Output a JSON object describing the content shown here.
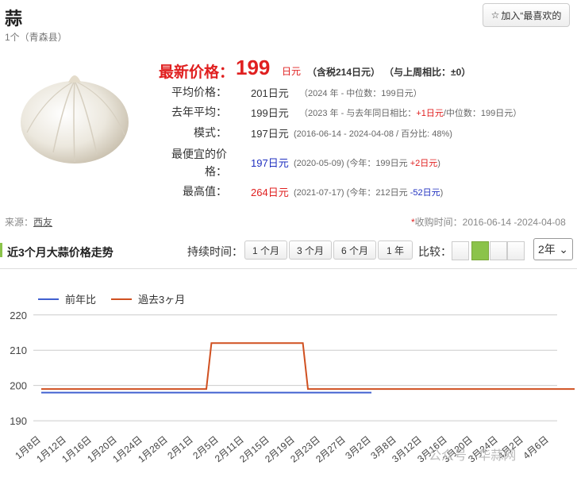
{
  "header": {
    "title": "蒜",
    "subtitle": "1个（青森县）",
    "favorite_label": "加入“最喜欢的"
  },
  "price": {
    "latest_label": "最新价格：",
    "latest_value": "199",
    "latest_unit": "日元",
    "latest_tax": "（含税214日元）",
    "latest_week": "（与上周相比：±0）",
    "rows": [
      {
        "label": "平均价格：",
        "value": "201日元",
        "value_color": "normal",
        "note": "（2024 年 - 中位数：199日元）"
      },
      {
        "label": "去年平均：",
        "value": "199日元",
        "value_color": "normal",
        "note_a": "（2023 年 - 与去年同日相比：",
        "note_b": "+1日元",
        "note_c": "/中位数：199日元）"
      },
      {
        "label": "模式：",
        "value": "197日元",
        "value_color": "normal",
        "note": "(2016-06-14 - 2024-04-08 / 百分比: 48%)"
      },
      {
        "label_a": "最便宜的价",
        "label_b": "格：",
        "value": "197日元",
        "value_color": "blue",
        "note_a": "(2020-05-09) (今年：199日元 ",
        "note_b": "+2日元",
        "note_c": ")"
      },
      {
        "label": "最高值：",
        "value": "264日元",
        "value_color": "red",
        "note_a": "(2021-07-17) (今年：212日元 ",
        "note_b": "-52日元",
        "note_c": ")"
      }
    ]
  },
  "source": {
    "label": "来源：",
    "link": "西友"
  },
  "period": {
    "asterisk": "*",
    "text": "收购时间：2016-06-14 -2024-04-08"
  },
  "section": {
    "title": "近3个月大蒜价格走势"
  },
  "controls": {
    "duration_label": "持续时间：",
    "durations": [
      "1 个月",
      "3 个月",
      "6 个月",
      "1 年"
    ],
    "compare_label": "比较：",
    "year_select": "2年"
  },
  "watermark": "公众号 · 华蒜网",
  "colors": {
    "accent_red": "#e02020",
    "blue": "#2030c0",
    "green": "#8bc34a",
    "series_prev": "#4060d0",
    "series_3m": "#d05020"
  },
  "chart_data": {
    "type": "line",
    "legend": [
      "前年比",
      "過去3ヶ月"
    ],
    "ylim": [
      188,
      224
    ],
    "yticks": [
      190,
      200,
      210,
      220
    ],
    "xticks": [
      "1月8日",
      "1月12日",
      "1月16日",
      "1月20日",
      "1月24日",
      "1月28日",
      "2月1日",
      "2月5日",
      "2月11日",
      "2月15日",
      "2月19日",
      "2月23日",
      "2月27日",
      "3月2日",
      "3月8日",
      "3月12日",
      "3月16日",
      "3月20日",
      "3月24日",
      "4月2日",
      "4月6日"
    ],
    "series": [
      {
        "name": "前年比",
        "color": "#4060d0",
        "x": [
          0,
          13,
          13.5,
          21
        ],
        "y": [
          198,
          198,
          null,
          198
        ]
      },
      {
        "name": "過去3ヶ月",
        "color": "#d05020",
        "x": [
          0,
          6.5,
          6.7,
          10.3,
          10.5,
          21
        ],
        "y": [
          199,
          199,
          212,
          212,
          199,
          199
        ]
      }
    ]
  }
}
